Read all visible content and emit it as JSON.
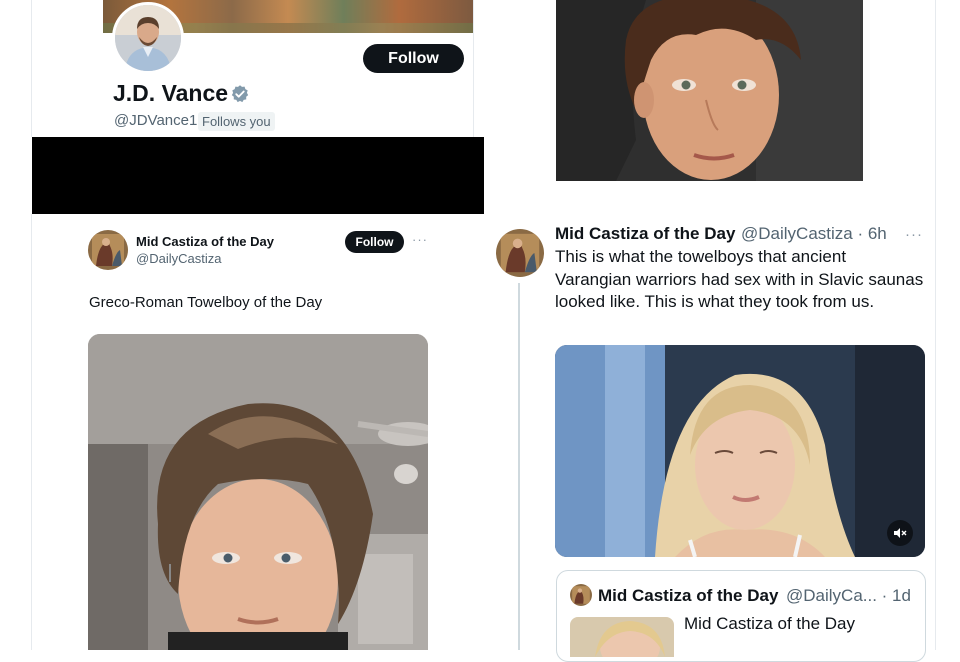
{
  "profile_card": {
    "name": "J.D. Vance",
    "handle": "@JDVance1",
    "follows_you": "Follows you",
    "follow_label": "Follow"
  },
  "tweet_left": {
    "author_name": "Mid Castiza of the Day",
    "author_handle": "@DailyCastiza",
    "follow_label": "Follow",
    "more": "···",
    "text": "Greco-Roman Towelboy of the Day"
  },
  "tweet_right": {
    "author_name": "Mid Castiza of the Day",
    "handle_time": "@DailyCastiza · 6h",
    "more": "···",
    "text": "This is what the towelboys that ancient Varangian warriors had sex with in Slavic saunas looked like. This is what they took from us.",
    "quoted": {
      "author_name": "Mid Castiza of the Day",
      "handle_time": "@DailyCa... · 1d",
      "text": "Mid Castiza of the Day"
    }
  },
  "colors": {
    "text_primary": "#0f1419",
    "text_secondary": "#536471",
    "button_bg": "#0f1419",
    "verified": "#829aab",
    "border": "#cfd9de"
  }
}
